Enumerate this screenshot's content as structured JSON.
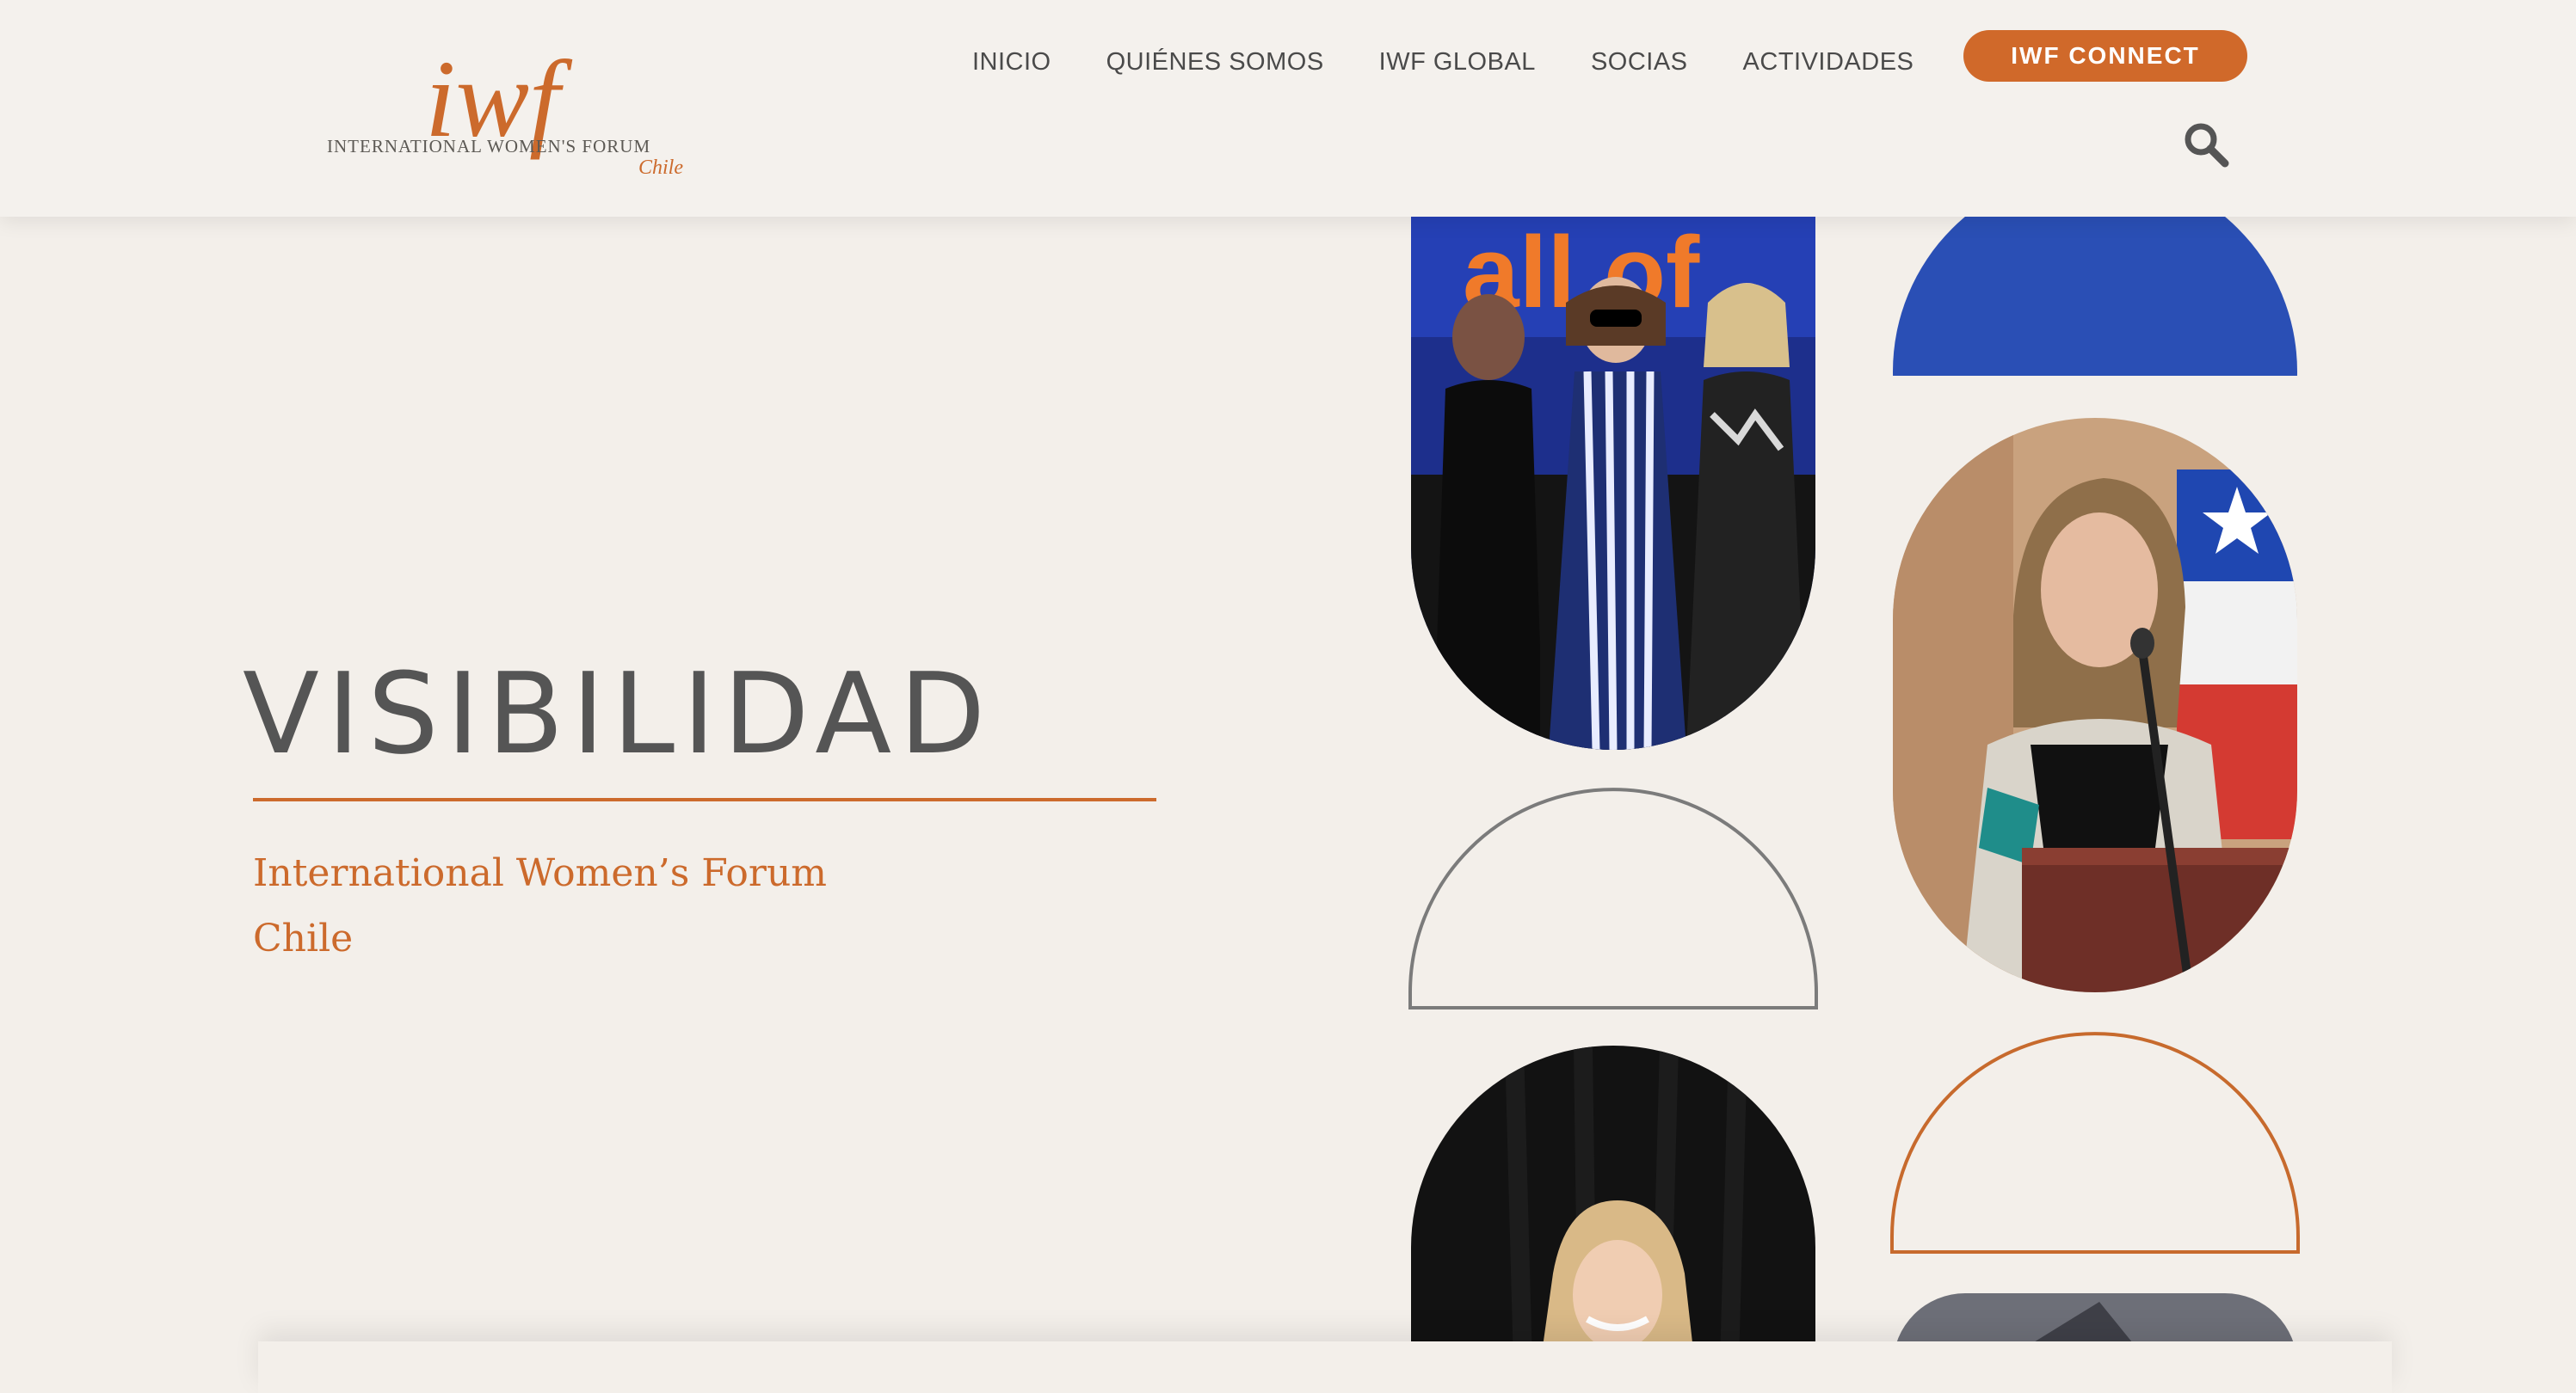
{
  "brand": {
    "logo_mark": "iwf",
    "logo_line": "INTERNATIONAL WOMEN'S FORUM",
    "logo_region": "Chile",
    "accent_color": "#cc6a2c"
  },
  "nav": {
    "items": [
      "INICIO",
      "QUIÉNES SOMOS",
      "IWF GLOBAL",
      "SOCIAS",
      "ACTIVIDADES"
    ],
    "cta_label": "IWF CONNECT",
    "search_icon": "search-icon"
  },
  "hero": {
    "title": "VISIBILIDAD",
    "subtitle_line1": "International Women’s Forum",
    "subtitle_line2": "Chile"
  },
  "collage": {
    "photo_1_banner_text": "all of"
  }
}
